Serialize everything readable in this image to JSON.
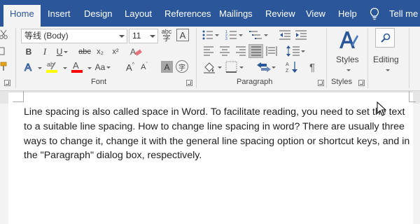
{
  "tabs": [
    {
      "label": "Home",
      "active": true
    },
    {
      "label": "Insert"
    },
    {
      "label": "Design"
    },
    {
      "label": "Layout"
    },
    {
      "label": "References"
    },
    {
      "label": "Mailings"
    },
    {
      "label": "Review"
    },
    {
      "label": "View"
    },
    {
      "label": "Help"
    }
  ],
  "tell_me": "Tell me",
  "font": {
    "name": "等线 (Body)",
    "size": "11",
    "group_label": "Font",
    "bold": "B",
    "italic": "I",
    "underline": "U",
    "strikethrough": "abc",
    "subscript": "x₂",
    "superscript": "x²",
    "change_case": "Aa",
    "grow": "A",
    "shrink": "A",
    "char_shading": "A",
    "enclose": "字",
    "phonetic_guide": "abc",
    "char_border": "A"
  },
  "paragraph": {
    "group_label": "Paragraph",
    "show_marks": "¶"
  },
  "styles": {
    "label": "Styles",
    "group_label": "Styles"
  },
  "editing": {
    "label": "Editing"
  },
  "colors": {
    "brand": "#2b579a",
    "highlight": "#ffff00",
    "font_color": "#ff0000",
    "text_effects": "#2b579a"
  },
  "document": {
    "text": "Line spacing is also called space in Word. To facilitate reading, you need to set the text to a suitable line spacing. How to change line spacing in word? There are usually three ways to change it, change it with the general line spacing option or shortcut keys, and in the \"Paragraph\" dialog box, respectively."
  }
}
